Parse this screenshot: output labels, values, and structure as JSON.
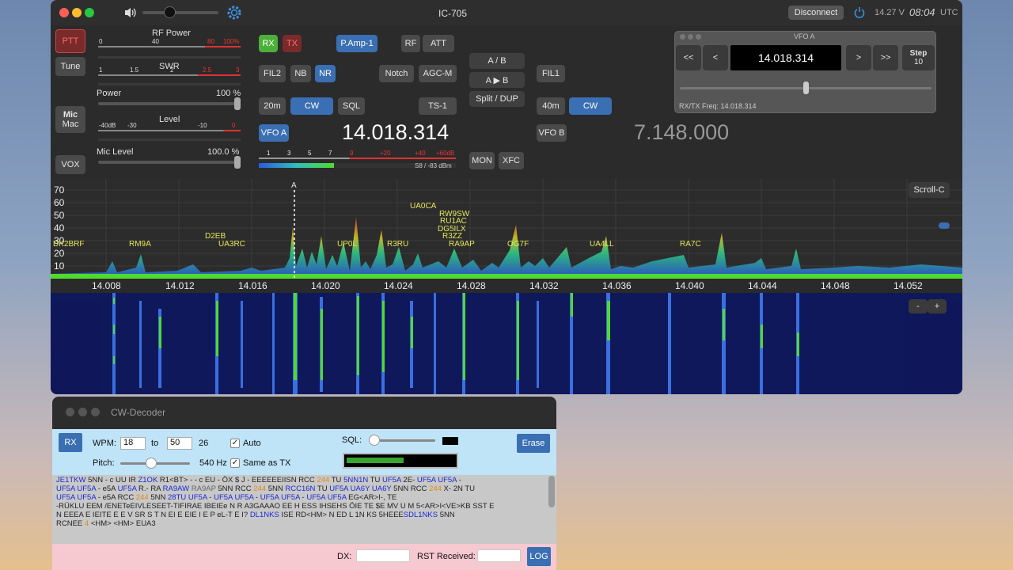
{
  "window": {
    "title": "IC-705",
    "disconnect_label": "Disconnect",
    "voltage": "14.27 V",
    "time": "08:04",
    "timezone": "UTC"
  },
  "left": {
    "ptt": "PTT",
    "tune": "Tune",
    "mic": "Mic",
    "mic_sub": "Mac",
    "vox": "VOX"
  },
  "meters": {
    "rf_power_label": "RF Power",
    "rf_ticks": [
      "0",
      "40",
      "80",
      "100%"
    ],
    "swr_label": "SWR",
    "swr_ticks": [
      "1",
      "1.5",
      "2",
      "2.5",
      "3"
    ],
    "power_label": "Power",
    "power_value": "100 %",
    "level_label": "Level",
    "level_ticks": [
      "-40dB",
      "-30",
      "-10",
      "0"
    ],
    "mic_level_label": "Mic Level",
    "mic_level_value": "100.0 %"
  },
  "controls": {
    "rx": "RX",
    "tx": "TX",
    "pamp": "P.Amp-1",
    "rf": "RF",
    "att": "ATT",
    "fil2": "FIL2",
    "nb": "NB",
    "nr": "NR",
    "notch": "Notch",
    "agcm": "AGC-M",
    "band_a": "20m",
    "mode_a": "CW",
    "sql": "SQL",
    "ts": "TS-1",
    "vfo_a": "VFO A",
    "freq_a": "14.018.314",
    "smeter_ticks": [
      "1",
      "3",
      "5",
      "7",
      "9",
      "+20",
      "+40",
      "+60dB"
    ],
    "smeter_reading": "S8 / -83 dBm",
    "ab": "A / B",
    "a_to_b": "A ▶ B",
    "split": "Split / DUP",
    "mon": "MON",
    "xfc": "XFC",
    "fil1": "FIL1",
    "band_b": "40m",
    "mode_b": "CW",
    "vfo_b": "VFO B",
    "freq_b": "7.148.000"
  },
  "vfo_panel": {
    "title": "VFO A",
    "btn_ll": "<<",
    "btn_l": "<",
    "freq": "14.018.314",
    "btn_r": ">",
    "btn_rr": ">>",
    "step_label": "Step",
    "step_value": "10",
    "rxtx": "RX/TX Freq: 14.018.314"
  },
  "spectrum": {
    "y_ticks": [
      "70",
      "60",
      "50",
      "40",
      "30",
      "20",
      "10"
    ],
    "freq_ticks": [
      "14.008",
      "14.012",
      "14.016",
      "14.020",
      "14.024",
      "14.028",
      "14.032",
      "14.036",
      "14.040",
      "14.044",
      "14.048",
      "14.052"
    ],
    "marker": "A",
    "scroll": "Scroll-C",
    "zoom_minus": "-",
    "zoom_plus": "+",
    "stations": [
      "DK2BRF",
      "RM9A",
      "D2EB",
      "UA3RC",
      "UP0L",
      "R3RU",
      "UA0CA",
      "RW9SW",
      "RU1AC",
      "DG5ILX",
      "R3ZZ",
      "RA9AP",
      "OG7F",
      "UA4LL",
      "RA7C"
    ]
  },
  "decoder": {
    "title": "CW-Decoder",
    "rx": "RX",
    "wpm_label": "WPM:",
    "wpm_from": "18",
    "to_label": "to",
    "wpm_to": "50",
    "wpm_current": "26",
    "auto": "Auto",
    "sql_label": "SQL:",
    "erase": "Erase",
    "pitch_label": "Pitch:",
    "pitch_value": "540 Hz",
    "same_tx": "Same as TX",
    "dx_label": "DX:",
    "rst_label": "RST Received:",
    "log": "LOG"
  }
}
